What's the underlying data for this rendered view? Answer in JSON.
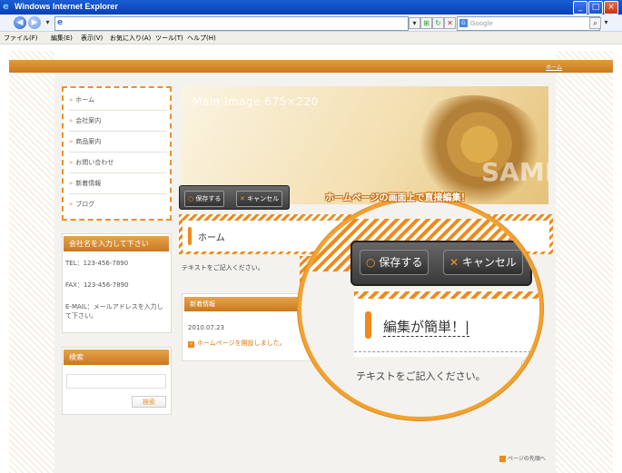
{
  "window": {
    "title": "Windows Internet Explorer"
  },
  "browser": {
    "menu": [
      "ファイル(F)",
      "編集(E)",
      "表示(V)",
      "お気に入り(A)",
      "ツール(T)",
      "ヘルプ(H)"
    ],
    "search_placeholder": "Google",
    "address_icon": "e"
  },
  "site": {
    "top_link": "ホーム",
    "nav": [
      "ホーム",
      "会社案内",
      "商品案内",
      "お問い合わせ",
      "新着情報",
      "ブログ"
    ],
    "company": {
      "heading": "会社名を入力して下さい",
      "tel": "TEL：123-456-7890",
      "fax": "FAX：123-456-7890",
      "email": "E-MAIL：メールアドレスを入力して下さい。"
    },
    "search": {
      "heading": "検索",
      "button": "検索"
    },
    "main_image": {
      "label": "Main Image  675×220",
      "sample": "SAMPLE"
    },
    "toolbar": {
      "save": "保存する",
      "cancel": "キャンセル"
    },
    "heading": "ホーム",
    "body_text": "テキストをご記入ください。",
    "news": {
      "heading": "新着情報",
      "date": "2010.07.23",
      "item": "ホームページを開設しました。"
    },
    "page_top": "ページの先頭へ"
  },
  "callout": {
    "title": "ホームページの画面上で直接編集！",
    "save": "保存する",
    "cancel": "キャンセル",
    "edit_text": "編集が簡単！|",
    "body_text": "テキストをご記入ください。",
    "partial_button": "ページへ"
  },
  "colors": {
    "accent": "#f08a1a",
    "titlebar": "#0a3fb4"
  }
}
